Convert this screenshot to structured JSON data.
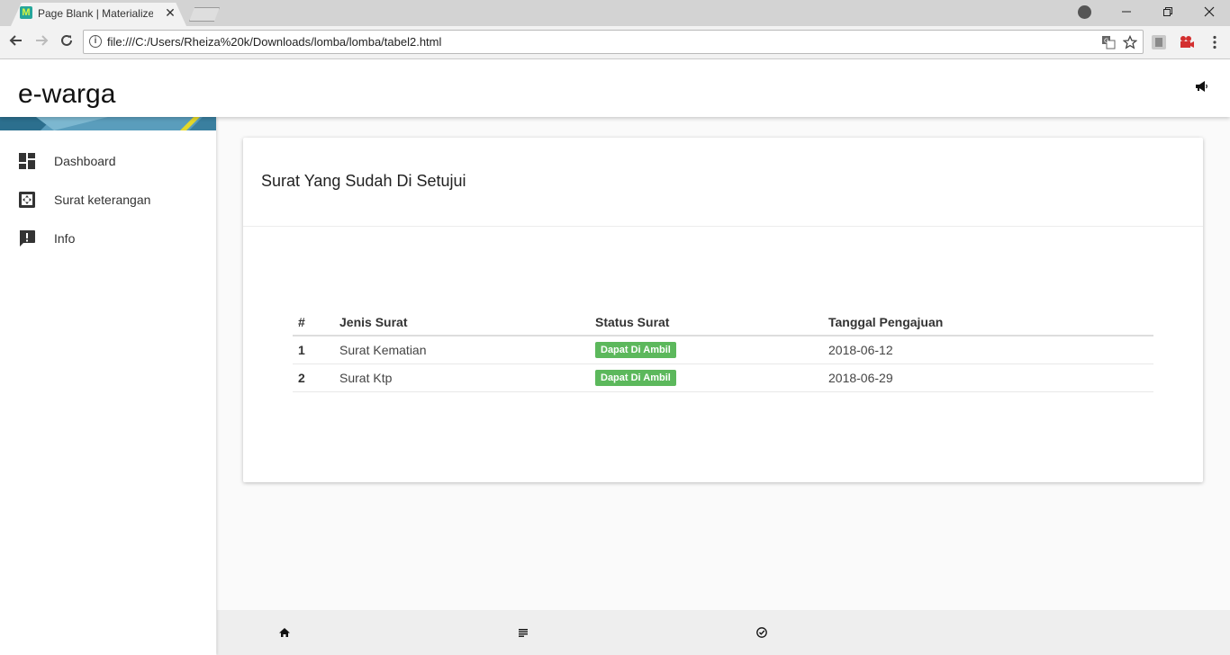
{
  "browser": {
    "tab_title": "Page Blank | Materialize -",
    "tab_favicon": "M",
    "tab_close": "✕",
    "url": "file:///C:/Users/Rheiza%20k/Downloads/lomba/lomba/tabel2.html",
    "icons": [
      "back-icon",
      "forward-icon",
      "reload-icon",
      "info-icon",
      "translate-icon",
      "star-icon",
      "profile-icon",
      "menu-icon"
    ]
  },
  "header": {
    "brand": "e-warga",
    "icon": "megaphone-icon"
  },
  "sidebar": {
    "items": [
      {
        "label": "Dashboard",
        "icon": "dashboard-icon"
      },
      {
        "label": "Surat keterangan",
        "icon": "settings-overscan-icon"
      },
      {
        "label": "Info",
        "icon": "feedback-icon"
      }
    ]
  },
  "card": {
    "title": "Surat Yang Sudah Di Setujui",
    "table": {
      "headers": [
        "#",
        "Jenis Surat",
        "Status Surat",
        "Tanggal Pengajuan"
      ],
      "rows": [
        {
          "no": "1",
          "jenis": "Surat Kematian",
          "status": "Dapat Di Ambil",
          "tanggal": "2018-06-12"
        },
        {
          "no": "2",
          "jenis": "Surat Ktp",
          "status": "Dapat Di Ambil",
          "tanggal": "2018-06-29"
        }
      ]
    }
  },
  "bottom_nav": {
    "icons": [
      "home-icon",
      "list-icon",
      "check-circle-icon"
    ]
  },
  "colors": {
    "status_success": "#5cb85c",
    "bottom_nav_bg": "#eeeeee"
  }
}
